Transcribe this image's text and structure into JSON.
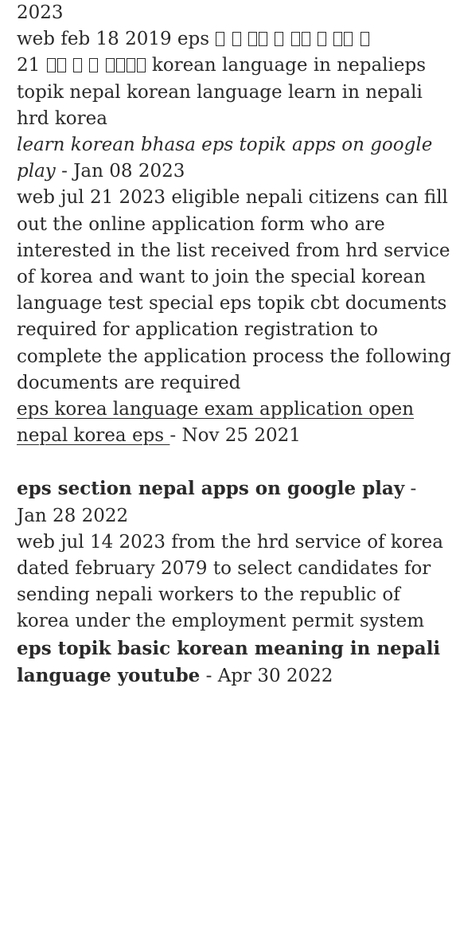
{
  "fragment_top": "2023",
  "snippets": [
    {
      "text_before": "web feb 18 2019   eps ",
      "glyph_groups": [
        1,
        1,
        2,
        1,
        2,
        1,
        2,
        1
      ],
      "text_line2_prefix": "21 ",
      "glyph_groups_line2": [
        2,
        1,
        1,
        4
      ],
      "text_after": " korean language in nepalieps topik nepal korean language learn in nepali hrd korea"
    }
  ],
  "results": [
    {
      "title": "learn korean bhasa eps topik apps on google play",
      "separator": " - ",
      "date": "Jan 08 2023",
      "style": "italic",
      "snippet": "web jul 21 2023   eligible nepali citizens can fill out the online application form who are interested in the list received from hrd service of korea and want to join the special korean language test special eps topik cbt documents required for application registration to complete the application process the following documents are required"
    },
    {
      "title": "eps korea language exam application open nepal korea eps ",
      "separator": "- ",
      "date": "Nov 25 2021",
      "style": "underline",
      "snippet": ""
    },
    {
      "title": "eps section nepal apps on google play",
      "separator": " - ",
      "date": "Jan 28 2022",
      "style": "bold",
      "snippet": "web jul 14 2023   from the hrd service of korea dated february 2079 to select candidates for sending nepali workers to the republic of korea under the employment permit system"
    },
    {
      "title": "eps topik basic korean meaning in nepali language youtube",
      "separator": " - ",
      "date": "Apr 30 2022",
      "style": "bold",
      "snippet": ""
    }
  ]
}
